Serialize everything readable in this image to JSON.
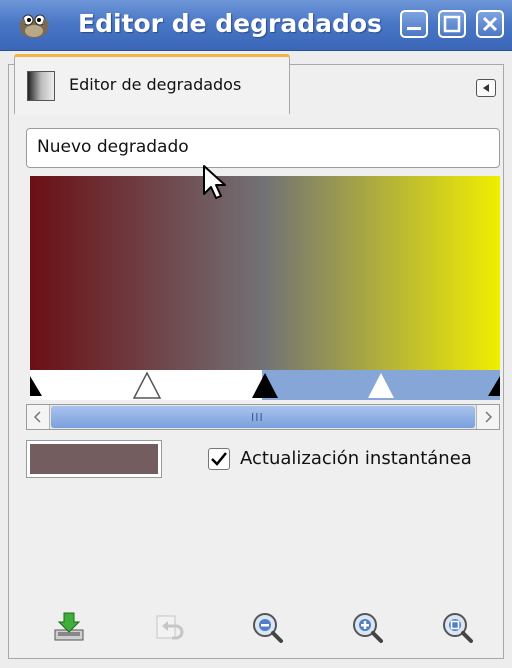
{
  "window": {
    "title": "Editor de degradados"
  },
  "tab": {
    "label": "Editor de degradados"
  },
  "gradient": {
    "name": "Nuevo degradado",
    "start_color": "#6b0f14",
    "mid_color": "#727276",
    "end_color": "#f0ee00"
  },
  "color_swatch": {
    "color": "#735d5f"
  },
  "instant_update": {
    "label": "Actualización instantánea",
    "checked": true
  },
  "toolbar": {
    "icons": [
      "save-icon",
      "revert-icon",
      "zoom-out-icon",
      "zoom-in-icon",
      "zoom-all-icon"
    ]
  }
}
